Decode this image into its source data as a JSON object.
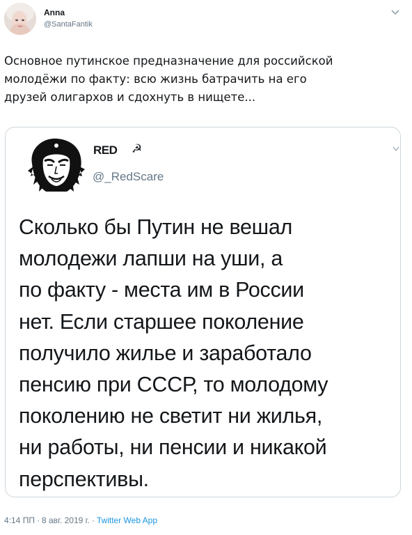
{
  "tweet": {
    "author": {
      "name": "Anna",
      "handle": "@SantaFantik"
    },
    "text_lines": [
      "Основное путинское предназначение для российской",
      "молодёжи по факту: всю жизнь батрачить на его",
      "друзей олигархов и сдохнуть в нищете..."
    ],
    "meta": {
      "time": "4:14 ПП",
      "separator": "·",
      "date": "8 авг. 2019 г.",
      "app": "Twitter Web App"
    }
  },
  "quote": {
    "author": {
      "name": "RED",
      "name_symbol": "☭",
      "handle": "@_RedScare"
    },
    "text_lines": [
      "Сколько бы Путин не вешал",
      "молодежи лапши на уши, а",
      "по факту - места им в России",
      "нет. Если старшее поколение",
      "получило жилье и заработало",
      "пенсию при СССР, то молодому",
      "поколению не светит ни жилья,",
      "ни работы, ни пенсии и никакой",
      "перспективы."
    ]
  },
  "colors": {
    "text": "#14171a",
    "secondary": "#657786",
    "link": "#1b95e0",
    "border": "#ccd6dd"
  },
  "icons": {
    "menu": "chevron-down-icon",
    "quote_menu": "chevron-down-icon"
  }
}
